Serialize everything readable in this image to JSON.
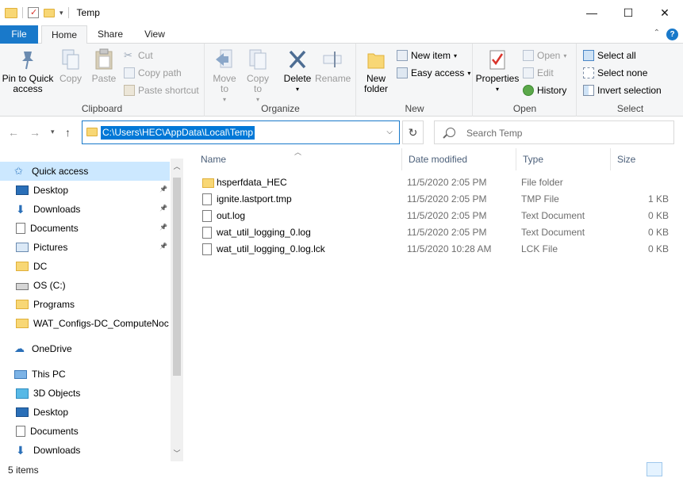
{
  "window": {
    "title": "Temp",
    "minimize": "—",
    "maximize": "☐",
    "close": "✕"
  },
  "tabs": {
    "file": "File",
    "home": "Home",
    "share": "Share",
    "view": "View"
  },
  "ribbon": {
    "clipboard": {
      "label": "Clipboard",
      "pin": "Pin to Quick access",
      "copy": "Copy",
      "paste": "Paste",
      "cut": "Cut",
      "copy_path": "Copy path",
      "paste_shortcut": "Paste shortcut"
    },
    "organize": {
      "label": "Organize",
      "move_to": "Move to",
      "copy_to": "Copy to",
      "delete": "Delete",
      "rename": "Rename"
    },
    "new": {
      "label": "New",
      "new_folder": "New folder",
      "new_item": "New item",
      "easy_access": "Easy access"
    },
    "open": {
      "label": "Open",
      "properties": "Properties",
      "open": "Open",
      "edit": "Edit",
      "history": "History"
    },
    "select": {
      "label": "Select",
      "select_all": "Select all",
      "select_none": "Select none",
      "invert_selection": "Invert selection"
    }
  },
  "address": {
    "path": "C:\\Users\\HEC\\AppData\\Local\\Temp",
    "search_placeholder": "Search Temp"
  },
  "sidebar": {
    "items": [
      {
        "label": "Quick access",
        "icon": "star-icon",
        "pinned": false
      },
      {
        "label": "Desktop",
        "icon": "desktop-icon",
        "pinned": true
      },
      {
        "label": "Downloads",
        "icon": "download-arrow-icon",
        "pinned": true
      },
      {
        "label": "Documents",
        "icon": "documents-icon",
        "pinned": true
      },
      {
        "label": "Pictures",
        "icon": "pictures-icon",
        "pinned": true
      },
      {
        "label": "DC",
        "icon": "folder-icon",
        "pinned": false
      },
      {
        "label": "OS (C:)",
        "icon": "drive-icon",
        "pinned": false
      },
      {
        "label": "Programs",
        "icon": "folder-icon",
        "pinned": false
      },
      {
        "label": "WAT_Configs-DC_ComputeNoc",
        "icon": "folder-icon",
        "pinned": false
      },
      {
        "label": "OneDrive",
        "icon": "cloud-icon",
        "pinned": false
      },
      {
        "label": "This PC",
        "icon": "computer-icon",
        "pinned": false
      },
      {
        "label": "3D Objects",
        "icon": "cube-icon",
        "pinned": false
      },
      {
        "label": "Desktop",
        "icon": "desktop-icon",
        "pinned": false
      },
      {
        "label": "Documents",
        "icon": "documents-icon",
        "pinned": false
      },
      {
        "label": "Downloads",
        "icon": "download-arrow-icon",
        "pinned": false
      }
    ]
  },
  "columns": {
    "name": "Name",
    "date": "Date modified",
    "type": "Type",
    "size": "Size"
  },
  "files": [
    {
      "name": "hsperfdata_HEC",
      "date": "11/5/2020 2:05 PM",
      "type": "File folder",
      "size": "",
      "folder": true
    },
    {
      "name": "ignite.lastport.tmp",
      "date": "11/5/2020 2:05 PM",
      "type": "TMP File",
      "size": "1 KB",
      "folder": false
    },
    {
      "name": "out.log",
      "date": "11/5/2020 2:05 PM",
      "type": "Text Document",
      "size": "0 KB",
      "folder": false
    },
    {
      "name": "wat_util_logging_0.log",
      "date": "11/5/2020 2:05 PM",
      "type": "Text Document",
      "size": "0 KB",
      "folder": false
    },
    {
      "name": "wat_util_logging_0.log.lck",
      "date": "11/5/2020 10:28 AM",
      "type": "LCK File",
      "size": "0 KB",
      "folder": false
    }
  ],
  "status": {
    "count": "5 items"
  },
  "colors": {
    "accent": "#1979ca",
    "selection": "#cce8ff",
    "folder": "#f8d775"
  }
}
